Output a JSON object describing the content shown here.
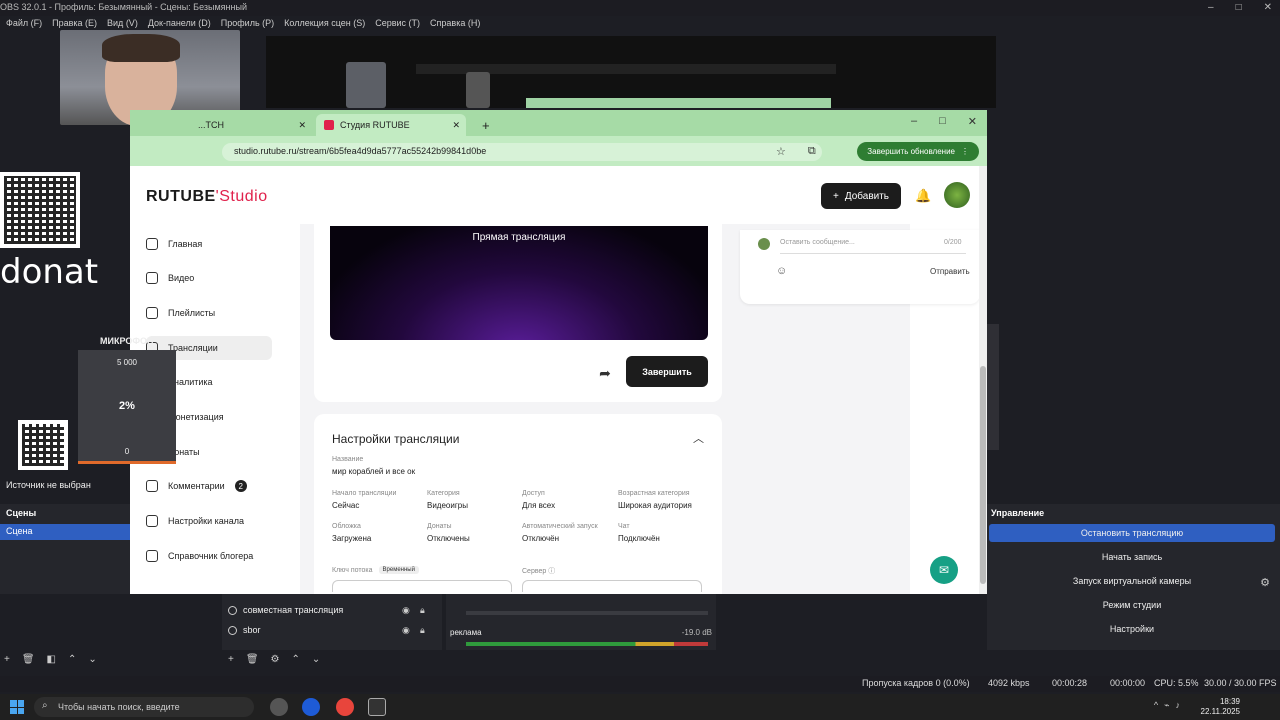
{
  "obs": {
    "title": "OBS 32.0.1 - Профиль: Безымянный - Сцены: Безымянный",
    "menu": [
      "Файл (F)",
      "Правка (E)",
      "Вид (V)",
      "Док-панели (D)",
      "Профиль (P)",
      "Коллекция сцен (S)",
      "Сервис (T)",
      "Справка (H)"
    ],
    "donat_label": "donat",
    "mic": {
      "label": "МИКРОФОН",
      "max": "5 000",
      "percent": "2%",
      "min": "0"
    },
    "no_source": "Источник не выбран",
    "scenes_header": "Сцены",
    "scene_item": "Сцена",
    "sources": [
      {
        "name": "совместная трансляция"
      },
      {
        "name": "sbor"
      }
    ],
    "mixer": {
      "label": "реклама",
      "db": "-19.0 dB"
    },
    "controls_header": "Управление",
    "controls": [
      "Остановить трансляцию",
      "Начать запись",
      "Запуск виртуальной камеры",
      "Режим студии",
      "Настройки"
    ],
    "status": {
      "dropped": "Пропуска кадров 0 (0.0%)",
      "bitrate": "4092 kbps",
      "stream_time": "00:00:28",
      "rec_time": "00:00:00",
      "cpu": "CPU: 5.5%",
      "fps": "30.00 / 30.00 FPS"
    }
  },
  "browser": {
    "prev_tab": "...TCH",
    "active_tab": "Студия RUTUBE",
    "url": "studio.rutube.ru/stream/6b5fea4d9da5777ac55242b99841d0be",
    "update_button": "Завершить обновление"
  },
  "studio": {
    "logo_brand": "RUTUBE",
    "logo_product": "Studio",
    "add_button": "Добавить",
    "nav": [
      {
        "label": "Главная",
        "icon": "home-icon"
      },
      {
        "label": "Видео",
        "icon": "video-icon"
      },
      {
        "label": "Плейлисты",
        "icon": "playlist-icon"
      },
      {
        "label": "Трансляции",
        "icon": "broadcast-icon"
      },
      {
        "label": "Аналитика",
        "icon": "analytics-icon"
      },
      {
        "label": "Монетизация",
        "icon": "money-icon"
      },
      {
        "label": "Донаты",
        "icon": "donate-icon"
      },
      {
        "label": "Комментарии",
        "icon": "comment-icon",
        "badge": "2"
      },
      {
        "label": "Настройки канала",
        "icon": "settings-icon"
      },
      {
        "label": "Справочник блогера",
        "icon": "info-icon"
      }
    ],
    "player_title": "Прямая трансляция",
    "finish_button": "Завершить",
    "settings": {
      "title": "Настройки трансляции",
      "name_label": "Название",
      "name_value": "мир кораблей и все ок",
      "start_label": "Начало трансляции",
      "start_value": "Сейчас",
      "category_label": "Категория",
      "category_value": "Видеоигры",
      "access_label": "Доступ",
      "access_value": "Для всех",
      "age_label": "Возрастная категория",
      "age_value": "Широкая аудитория",
      "cover_label": "Обложка",
      "cover_value": "Загружена",
      "donate_label": "Донаты",
      "donate_value": "Отключены",
      "autostart_label": "Автоматический запуск",
      "autostart_value": "Отключён",
      "chat_label": "Чат",
      "chat_value": "Подключён",
      "key_label": "Ключ потока",
      "key_badge": "Временный",
      "server_label": "Сервер"
    },
    "chat": {
      "placeholder": "Оставить сообщение...",
      "counter": "0/200",
      "send": "Отправить"
    }
  },
  "taskbar": {
    "search_placeholder": "Чтобы начать поиск, введите",
    "time": "18:39",
    "date": "22.11.2025"
  }
}
